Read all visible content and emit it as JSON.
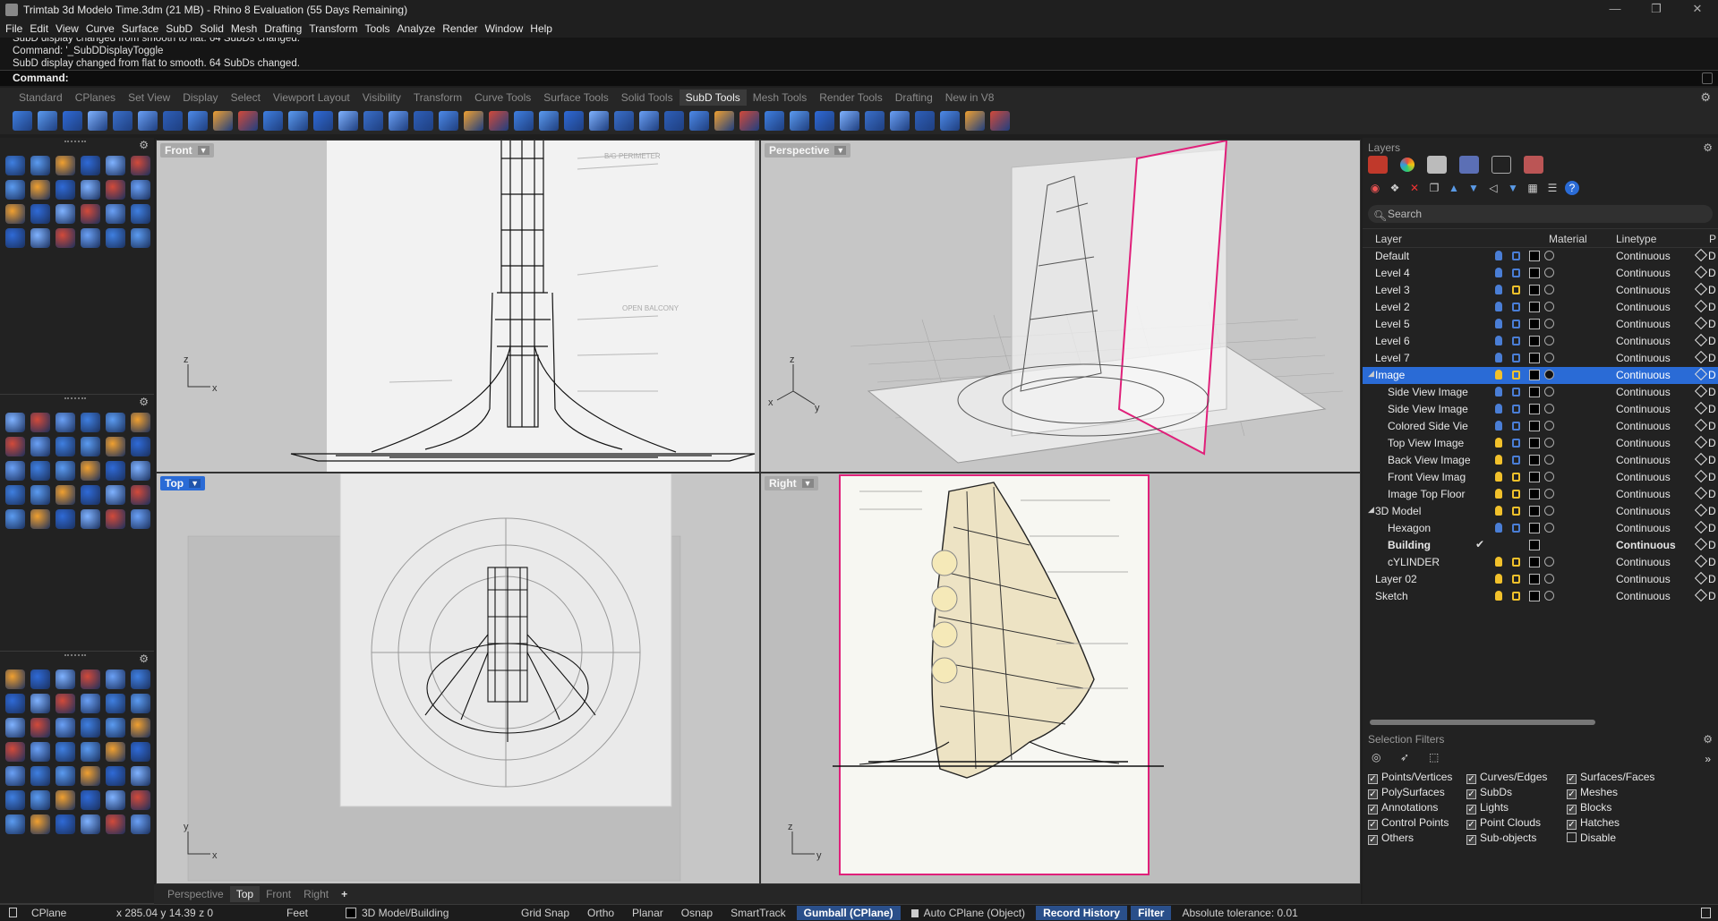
{
  "window": {
    "title": "Trimtab 3d Modelo Time.3dm (21 MB) - Rhino 8 Evaluation (55 Days Remaining)",
    "controls": [
      "—",
      "❐",
      "✕"
    ]
  },
  "menu": [
    "File",
    "Edit",
    "View",
    "Curve",
    "Surface",
    "SubD",
    "Solid",
    "Mesh",
    "Drafting",
    "Transform",
    "Tools",
    "Analyze",
    "Render",
    "Window",
    "Help"
  ],
  "command_history": [
    "SubD display changed from smooth to flat. 64 SubDs changed.",
    "Command: '_SubDDisplayToggle",
    "SubD display changed from flat to smooth. 64 SubDs changed."
  ],
  "command_prompt": "Command:",
  "tool_tabs": {
    "items": [
      "Standard",
      "CPlanes",
      "Set View",
      "Display",
      "Select",
      "Viewport Layout",
      "Visibility",
      "Transform",
      "Curve Tools",
      "Surface Tools",
      "Solid Tools",
      "SubD Tools",
      "Mesh Tools",
      "Render Tools",
      "Drafting",
      "New in V8"
    ],
    "active": "SubD Tools"
  },
  "viewports": {
    "front": "Front",
    "perspective": "Perspective",
    "top": "Top",
    "right": "Right",
    "axes": {
      "x": "x",
      "y": "y",
      "z": "z"
    }
  },
  "viewport_tabs": {
    "items": [
      "Perspective",
      "Top",
      "Front",
      "Right"
    ],
    "active": "Top",
    "add": "+"
  },
  "status_bar": {
    "cplane": "CPlane",
    "coords": "x 285.04  y 14.39  z 0",
    "units": "Feet",
    "layer": "3D Model/Building",
    "grid_snap": "Grid Snap",
    "ortho": "Ortho",
    "planar": "Planar",
    "osnap": "Osnap",
    "smarttrack": "SmartTrack",
    "gumball": "Gumball (CPlane)",
    "auto_cplane": "Auto CPlane (Object)",
    "record_history": "Record History",
    "filter": "Filter",
    "tolerance": "Absolute tolerance: 0.01"
  },
  "layers_panel": {
    "title": "Layers",
    "search_placeholder": "Search",
    "columns": {
      "layer": "Layer",
      "material": "Material",
      "linetype": "Linetype",
      "extra": "P"
    },
    "rows": [
      {
        "name": "Default",
        "indent": 0,
        "linetype": "Continuous",
        "on": false,
        "locked": true
      },
      {
        "name": "Level 4",
        "indent": 0,
        "linetype": "Continuous",
        "on": false,
        "locked": true
      },
      {
        "name": "Level 3",
        "indent": 0,
        "linetype": "Continuous",
        "on": false,
        "locked": false
      },
      {
        "name": "Level 2",
        "indent": 0,
        "linetype": "Continuous",
        "on": false,
        "locked": true
      },
      {
        "name": "Level 5",
        "indent": 0,
        "linetype": "Continuous",
        "on": false,
        "locked": true
      },
      {
        "name": "Level 6",
        "indent": 0,
        "linetype": "Continuous",
        "on": false,
        "locked": true
      },
      {
        "name": "Level 7",
        "indent": 0,
        "linetype": "Continuous",
        "on": false,
        "locked": true
      },
      {
        "name": "Image",
        "indent": 0,
        "linetype": "Continuous",
        "on": true,
        "locked": false,
        "selected": true,
        "expand": "◢"
      },
      {
        "name": "Side View Image",
        "indent": 1,
        "linetype": "Continuous",
        "on": false,
        "locked": true
      },
      {
        "name": "Side View Image",
        "indent": 1,
        "linetype": "Continuous",
        "on": false,
        "locked": true
      },
      {
        "name": "Colored Side Vie",
        "indent": 1,
        "linetype": "Continuous",
        "on": false,
        "locked": true
      },
      {
        "name": "Top View Image",
        "indent": 1,
        "linetype": "Continuous",
        "on": true,
        "locked": true
      },
      {
        "name": "Back View Image",
        "indent": 1,
        "linetype": "Continuous",
        "on": true,
        "locked": true
      },
      {
        "name": "Front View Imag",
        "indent": 1,
        "linetype": "Continuous",
        "on": true,
        "locked": false
      },
      {
        "name": "Image Top Floor",
        "indent": 1,
        "linetype": "Continuous",
        "on": true,
        "locked": false
      },
      {
        "name": "3D Model",
        "indent": 0,
        "linetype": "Continuous",
        "on": true,
        "locked": false,
        "expand": "◢"
      },
      {
        "name": "Hexagon",
        "indent": 1,
        "linetype": "Continuous",
        "on": false,
        "locked": true
      },
      {
        "name": "Building",
        "indent": 1,
        "linetype": "Continuous",
        "current": true,
        "bold": true,
        "check": "✔"
      },
      {
        "name": "cYLINDER",
        "indent": 1,
        "linetype": "Continuous",
        "on": true,
        "locked": false
      },
      {
        "name": "Layer 02",
        "indent": 0,
        "linetype": "Continuous",
        "on": true,
        "locked": false
      },
      {
        "name": "Sketch",
        "indent": 0,
        "linetype": "Continuous",
        "on": true,
        "locked": false
      }
    ],
    "row_suffix": "D"
  },
  "selection_filters": {
    "title": "Selection Filters",
    "more": "»",
    "items": [
      {
        "label": "Points/Vertices",
        "checked": true
      },
      {
        "label": "Curves/Edges",
        "checked": true
      },
      {
        "label": "Surfaces/Faces",
        "checked": true
      },
      {
        "label": "PolySurfaces",
        "checked": true
      },
      {
        "label": "SubDs",
        "checked": true
      },
      {
        "label": "Meshes",
        "checked": true
      },
      {
        "label": "Annotations",
        "checked": true
      },
      {
        "label": "Lights",
        "checked": true
      },
      {
        "label": "Blocks",
        "checked": true
      },
      {
        "label": "Control Points",
        "checked": true
      },
      {
        "label": "Point Clouds",
        "checked": true
      },
      {
        "label": "Hatches",
        "checked": true
      },
      {
        "label": "Others",
        "checked": true
      },
      {
        "label": "Sub-objects",
        "checked": true
      },
      {
        "label": "Disable",
        "checked": false
      }
    ]
  },
  "colors": {
    "accent": "#2a6bd6",
    "bulb_on": "#f2c12b",
    "bulb_off": "#4a7ed6",
    "viewport_bg": "#c6c6c6",
    "magenta_border": "#e0207a"
  }
}
